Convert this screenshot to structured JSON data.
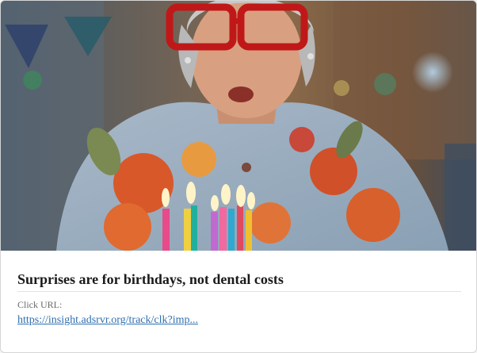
{
  "ad": {
    "image_alt": "Older woman with red glasses blowing out birthday candles",
    "headline": "Surprises are for birthdays, not dental costs",
    "click_label": "Click URL:",
    "click_url": "https://insight.adsrvr.org/track/clk?imp..."
  }
}
